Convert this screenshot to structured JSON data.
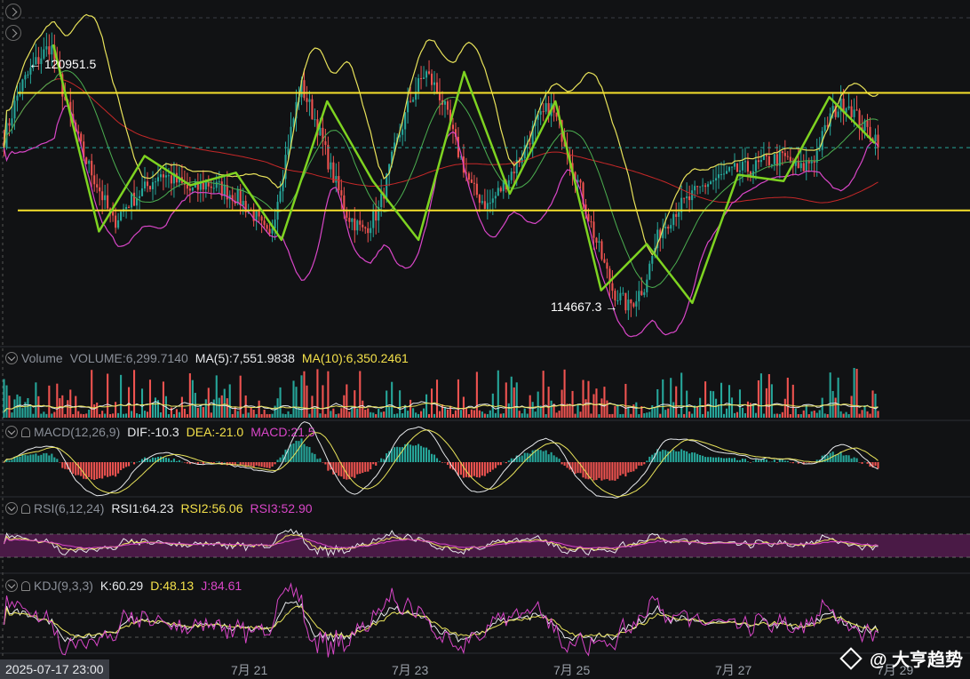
{
  "chart_data": [
    {
      "type": "candlestick",
      "title": "",
      "ylim": [
        113800,
        121800
      ],
      "x_start": "2025-07-17 23:00",
      "x_ticks": [
        "7月 21",
        "7月 23",
        "7月 25",
        "7月 27",
        "7月 29"
      ],
      "annotations": {
        "high_label": "120951.5",
        "low_label": "114667.3"
      },
      "close_path": [
        118700,
        119900,
        120500,
        120950,
        119500,
        118400,
        117600,
        116700,
        117200,
        117500,
        117900,
        117700,
        117450,
        117650,
        117500,
        117300,
        116900,
        116300,
        118200,
        120000,
        119100,
        117900,
        116900,
        116500,
        117000,
        118400,
        119600,
        120300,
        119700,
        118500,
        117500,
        117100,
        117600,
        118200,
        119000,
        119500,
        118600,
        117400,
        116200,
        115100,
        114700,
        115200,
        116500,
        117000,
        117300,
        117650,
        117800,
        117950,
        118000,
        118200,
        118250,
        117950,
        118300,
        119300,
        119600,
        119000,
        118700
      ],
      "horizontal_lines": [
        119800,
        117000
      ],
      "zigzag": [
        120951,
        116500,
        118300,
        117600,
        117900,
        116300,
        119600,
        117700,
        116300,
        120300,
        117400,
        119600,
        115100,
        116200,
        114800,
        117850,
        117700,
        119700,
        118600
      ]
    },
    {
      "type": "bar",
      "title": "Volume",
      "legend": {
        "volume": "VOLUME:6,299.7140",
        "ma5": "MA(5):7,551.9838",
        "ma10": "MA(10):6,350.2461"
      }
    },
    {
      "type": "bar",
      "title": "MACD(12,26,9)",
      "legend": {
        "dif": "DIF:-10.3",
        "dea": "DEA:-21.0",
        "macd": "MACD:21.5"
      }
    },
    {
      "type": "line",
      "title": "RSI(6,12,24)",
      "legend": {
        "rsi1": "RSI1:64.23",
        "rsi2": "RSI2:56.06",
        "rsi3": "RSI3:52.90"
      }
    },
    {
      "type": "line",
      "title": "KDJ(9,3,3)",
      "legend": {
        "k": "K:60.29",
        "d": "D:48.13",
        "j": "J:84.61"
      }
    }
  ],
  "ui": {
    "date_badge": "2025-07-17 23:00",
    "watermark": "@ 大亨趋势",
    "colors": {
      "up": "#26a69a",
      "down": "#ef5350",
      "hline": "#f7e12b",
      "zigzag": "#7ed321",
      "boll": "#e8e25a",
      "lower": "#d946c8"
    }
  }
}
